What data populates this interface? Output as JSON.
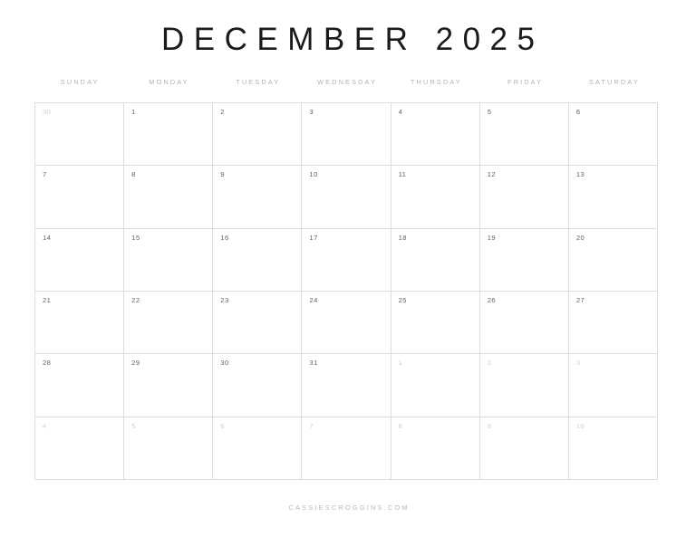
{
  "header": {
    "title": "DECEMBER 2025",
    "month_name": "DECEMBER",
    "year": "2025"
  },
  "weekdays": [
    {
      "label": "SUNDAY"
    },
    {
      "label": "MONDAY"
    },
    {
      "label": "TUESDAY"
    },
    {
      "label": "WEDNESDAY"
    },
    {
      "label": "THURSDAY"
    },
    {
      "label": "FRIDAY"
    },
    {
      "label": "SATURDAY"
    }
  ],
  "weeks": [
    {
      "days": [
        {
          "num": "30",
          "adjacent": true
        },
        {
          "num": "1",
          "adjacent": false
        },
        {
          "num": "2",
          "adjacent": false
        },
        {
          "num": "3",
          "adjacent": false
        },
        {
          "num": "4",
          "adjacent": false
        },
        {
          "num": "5",
          "adjacent": false
        },
        {
          "num": "6",
          "adjacent": false
        }
      ]
    },
    {
      "days": [
        {
          "num": "7",
          "adjacent": false
        },
        {
          "num": "8",
          "adjacent": false
        },
        {
          "num": "9",
          "adjacent": false
        },
        {
          "num": "10",
          "adjacent": false
        },
        {
          "num": "11",
          "adjacent": false
        },
        {
          "num": "12",
          "adjacent": false
        },
        {
          "num": "13",
          "adjacent": false
        }
      ]
    },
    {
      "days": [
        {
          "num": "14",
          "adjacent": false
        },
        {
          "num": "15",
          "adjacent": false
        },
        {
          "num": "16",
          "adjacent": false
        },
        {
          "num": "17",
          "adjacent": false
        },
        {
          "num": "18",
          "adjacent": false
        },
        {
          "num": "19",
          "adjacent": false
        },
        {
          "num": "20",
          "adjacent": false
        }
      ]
    },
    {
      "days": [
        {
          "num": "21",
          "adjacent": false
        },
        {
          "num": "22",
          "adjacent": false
        },
        {
          "num": "23",
          "adjacent": false
        },
        {
          "num": "24",
          "adjacent": false
        },
        {
          "num": "25",
          "adjacent": false
        },
        {
          "num": "26",
          "adjacent": false
        },
        {
          "num": "27",
          "adjacent": false
        }
      ]
    },
    {
      "days": [
        {
          "num": "28",
          "adjacent": false
        },
        {
          "num": "29",
          "adjacent": false
        },
        {
          "num": "30",
          "adjacent": false
        },
        {
          "num": "31",
          "adjacent": false
        },
        {
          "num": "1",
          "adjacent": true
        },
        {
          "num": "2",
          "adjacent": true
        },
        {
          "num": "3",
          "adjacent": true
        }
      ]
    },
    {
      "days": [
        {
          "num": "4",
          "adjacent": true
        },
        {
          "num": "5",
          "adjacent": true
        },
        {
          "num": "6",
          "adjacent": true
        },
        {
          "num": "7",
          "adjacent": true
        },
        {
          "num": "8",
          "adjacent": true
        },
        {
          "num": "9",
          "adjacent": true
        },
        {
          "num": "10",
          "adjacent": true
        }
      ]
    }
  ],
  "footer": {
    "credit": "CASSIESCROGGINS.COM"
  },
  "colors": {
    "page_background": "#ffffff",
    "title_text": "#1b1b1b",
    "weekday_text": "#b2b2b2",
    "grid_line": "#dddddd",
    "day_text": "#616161",
    "day_text_adjacent": "#d0d0d0",
    "footer_text": "#b9b9b9"
  }
}
